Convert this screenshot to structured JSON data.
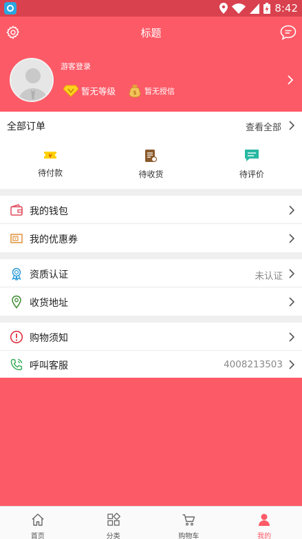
{
  "status_bar": {
    "time": "8:42"
  },
  "header": {
    "title": "标题"
  },
  "profile": {
    "guest_text": "游客登录",
    "level_text": "暂无等级",
    "credit_text": "暂无授信"
  },
  "orders": {
    "title": "全部订单",
    "view_all": "查看全部",
    "items": [
      {
        "label": "待付款",
        "icon": "wallet-pay-icon"
      },
      {
        "label": "待收货",
        "icon": "receipt-icon"
      },
      {
        "label": "待评价",
        "icon": "comment-icon"
      }
    ]
  },
  "menu": {
    "wallet": {
      "label": "我的钱包"
    },
    "coupons": {
      "label": "我的优惠券"
    },
    "qualification": {
      "label": "资质认证",
      "value": "未认证"
    },
    "address": {
      "label": "收货地址"
    },
    "notice": {
      "label": "购物须知"
    },
    "service": {
      "label": "呼叫客服",
      "value": "4008213503"
    }
  },
  "tabbar": {
    "items": [
      {
        "label": "首页"
      },
      {
        "label": "分类"
      },
      {
        "label": "购物车"
      },
      {
        "label": "我的"
      }
    ],
    "active_index": 3
  },
  "colors": {
    "brand": "#fd5a67",
    "section_bg": "#ffffff",
    "gap_bg": "#efefef"
  }
}
